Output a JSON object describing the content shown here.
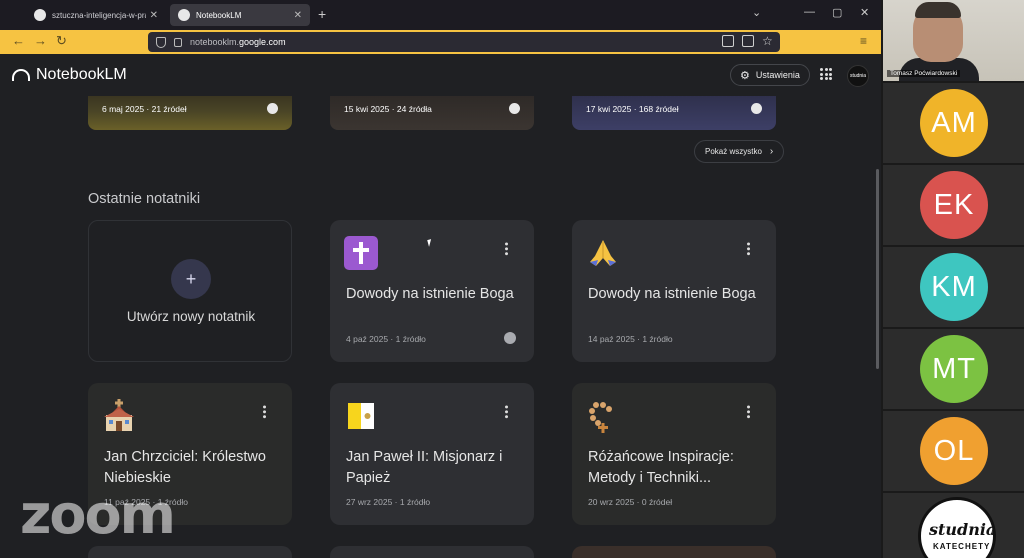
{
  "browser": {
    "tabs": [
      {
        "label": "sztuczna-inteligencja-w-pracy-katech"
      },
      {
        "label": "NotebookLM"
      }
    ],
    "url": {
      "prefix": "notebooklm.",
      "domain": "google.com"
    }
  },
  "app": {
    "name": "NotebookLM",
    "settings_label": "Ustawienia",
    "avatar_text": "studnia"
  },
  "featured": [
    {
      "meta": "6 maj 2025 · 21 źródeł"
    },
    {
      "meta": "15 kwi 2025 · 24 źródła"
    },
    {
      "meta": "17 kwi 2025 · 168 źródeł"
    }
  ],
  "show_all_label": "Pokaż wszystko",
  "recent": {
    "title": "Ostatnie notatniki",
    "new_label": "Utwórz nowy notatnik",
    "cards": [
      {
        "title": "Dowody na istnienie Boga",
        "meta": "4 paź 2025 · 1 źródło",
        "icon": "cross-icon",
        "public": true
      },
      {
        "title": "Dowody na istnienie Boga",
        "meta": "14 paź 2025 · 1 źródło",
        "icon": "praying-hands-icon",
        "public": false
      },
      {
        "title": "Jan Chrzciciel: Królestwo Niebieskie",
        "meta": "11 paź 2025 · 1 źródło",
        "icon": "church-icon",
        "public": false
      },
      {
        "title": "Jan Paweł II: Misjonarz i Papież",
        "meta": "27 wrz 2025 · 1 źródło",
        "icon": "vatican-flag-icon",
        "public": false
      },
      {
        "title": "Różańcowe Inspiracje: Metody i Techniki...",
        "meta": "20 wrz 2025 · 0 źródeł",
        "icon": "rosary-icon",
        "public": false
      }
    ]
  },
  "overlay": {
    "zoom_watermark": "zoom"
  },
  "participants": {
    "video_name": "Tomasz Poćwiardowski",
    "tiles": [
      {
        "initials": "AM",
        "color": "#f0b429"
      },
      {
        "initials": "EK",
        "color": "#d9534f"
      },
      {
        "initials": "KM",
        "color": "#3ec6c0"
      },
      {
        "initials": "MT",
        "color": "#7cc242"
      },
      {
        "initials": "OL",
        "color": "#f0a030"
      }
    ],
    "logo_text": "studnia",
    "logo_sub": "KATECHETY"
  }
}
